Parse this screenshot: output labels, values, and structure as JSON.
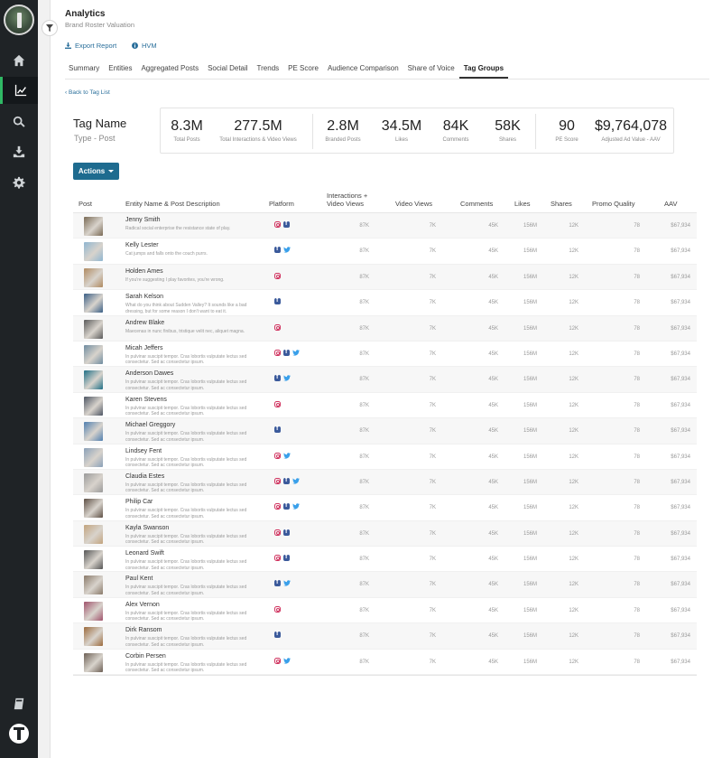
{
  "sidebar": {
    "items": [
      {
        "icon": "home-icon"
      },
      {
        "icon": "analytics-icon",
        "active": true
      },
      {
        "icon": "search-icon"
      },
      {
        "icon": "download-icon"
      },
      {
        "icon": "gear-icon"
      }
    ],
    "bottom_icon": "book-icon"
  },
  "header": {
    "title": "Analytics",
    "subtitle": "Brand Roster Valuation",
    "export_label": "Export Report",
    "hvm_label": "HVM"
  },
  "tabs": [
    {
      "label": "Summary"
    },
    {
      "label": "Entities"
    },
    {
      "label": "Aggregated Posts"
    },
    {
      "label": "Social Detail"
    },
    {
      "label": "Trends"
    },
    {
      "label": "PE Score"
    },
    {
      "label": "Audience Comparison"
    },
    {
      "label": "Share of Voice"
    },
    {
      "label": "Tag Groups",
      "active": true
    }
  ],
  "back_link": "Back to Tag List",
  "tag": {
    "name": "Tag Name",
    "type": "Type - Post"
  },
  "kpis": [
    {
      "value": "8.3M",
      "label": "Total Posts"
    },
    {
      "value": "277.5M",
      "label": "Total Interactions & Video Views"
    },
    {
      "value": "2.8M",
      "label": "Branded Posts"
    },
    {
      "value": "34.5M",
      "label": "Likes"
    },
    {
      "value": "84K",
      "label": "Comments"
    },
    {
      "value": "58K",
      "label": "Shares"
    },
    {
      "value": "90",
      "label": "PE Score"
    },
    {
      "value": "$9,764,078",
      "label": "Adjusted Ad Value - AAV"
    }
  ],
  "actions_label": "Actions",
  "table": {
    "headers": {
      "post": "Post",
      "entity": "Entity Name & Post Description",
      "platform": "Platform",
      "interactions_1": "Interactions +",
      "interactions_2": "Video Views",
      "video_views": "Video Views",
      "comments": "Comments",
      "likes": "Likes",
      "shares": "Shares",
      "promo": "Promo Quality",
      "aav": "AAV"
    },
    "rows": [
      {
        "name": "Jenny Smith",
        "desc": "Radical social enterprise the resistance state of play.",
        "platforms": [
          "ig",
          "fb"
        ],
        "interactions": "87K",
        "video_views": "7K",
        "comments": "45K",
        "likes": "156M",
        "shares": "12K",
        "promo": "78",
        "aav": "$67,934",
        "thumb": "#7a6a55"
      },
      {
        "name": "Kelly Lester",
        "desc": "Cat jumps and falls onto the couch purrs.",
        "platforms": [
          "fb",
          "tw"
        ],
        "interactions": "87K",
        "video_views": "7K",
        "comments": "45K",
        "likes": "156M",
        "shares": "12K",
        "promo": "78",
        "aav": "$67,934",
        "thumb": "#8fb6d1"
      },
      {
        "name": "Holden Ames",
        "desc": "If you're suggesting I play favorites, you're wrong.",
        "platforms": [
          "ig"
        ],
        "interactions": "87K",
        "video_views": "7K",
        "comments": "45K",
        "likes": "156M",
        "shares": "12K",
        "promo": "78",
        "aav": "$67,934",
        "thumb": "#b08a60"
      },
      {
        "name": "Sarah Kelson",
        "desc": "What do you think about Sudden Valley? It sounds like a bad dressing, but for some reason I don't want to eat it.",
        "platforms": [
          "fb"
        ],
        "interactions": "87K",
        "video_views": "7K",
        "comments": "45K",
        "likes": "156M",
        "shares": "12K",
        "promo": "78",
        "aav": "$67,934",
        "thumb": "#3a5f86"
      },
      {
        "name": "Andrew Blake",
        "desc": "Maecenas in nunc finibus, tristique velit nec, aliquet magna.",
        "platforms": [
          "ig"
        ],
        "interactions": "87K",
        "video_views": "7K",
        "comments": "45K",
        "likes": "156M",
        "shares": "12K",
        "promo": "78",
        "aav": "$67,934",
        "thumb": "#5a5a5a"
      },
      {
        "name": "Micah Jeffers",
        "desc": "In pulvinar suscipit tempor. Cras lobortis vulputate lectus sed consectetur. Sed ac consectetur ipsum.",
        "platforms": [
          "ig",
          "fb",
          "tw"
        ],
        "interactions": "87K",
        "video_views": "7K",
        "comments": "45K",
        "likes": "156M",
        "shares": "12K",
        "promo": "78",
        "aav": "$67,934",
        "thumb": "#6f8ca0"
      },
      {
        "name": "Anderson Dawes",
        "desc": "In pulvinar suscipit tempor. Cras lobortis vulputate lectus sed consectetur. Sed ac consectetur ipsum.",
        "platforms": [
          "fb",
          "tw"
        ],
        "interactions": "87K",
        "video_views": "7K",
        "comments": "45K",
        "likes": "156M",
        "shares": "12K",
        "promo": "78",
        "aav": "$67,934",
        "thumb": "#1f6f86"
      },
      {
        "name": "Karen Stevens",
        "desc": "In pulvinar suscipit tempor. Cras lobortis vulputate lectus sed consectetur. Sed ac consectetur ipsum.",
        "platforms": [
          "ig"
        ],
        "interactions": "87K",
        "video_views": "7K",
        "comments": "45K",
        "likes": "156M",
        "shares": "12K",
        "promo": "78",
        "aav": "$67,934",
        "thumb": "#4d5563"
      },
      {
        "name": "Michael Greggory",
        "desc": "In pulvinar suscipit tempor. Cras lobortis vulputate lectus sed consectetur. Sed ac consectetur ipsum.",
        "platforms": [
          "fb"
        ],
        "interactions": "87K",
        "video_views": "7K",
        "comments": "45K",
        "likes": "156M",
        "shares": "12K",
        "promo": "78",
        "aav": "$67,934",
        "thumb": "#4f7fb0"
      },
      {
        "name": "Lindsey Fent",
        "desc": "In pulvinar suscipit tempor. Cras lobortis vulputate lectus sed consectetur. Sed ac consectetur ipsum.",
        "platforms": [
          "ig",
          "tw"
        ],
        "interactions": "87K",
        "video_views": "7K",
        "comments": "45K",
        "likes": "156M",
        "shares": "12K",
        "promo": "78",
        "aav": "$67,934",
        "thumb": "#8aa0b8"
      },
      {
        "name": "Claudia Estes",
        "desc": "In pulvinar suscipit tempor. Cras lobortis vulputate lectus sed consectetur. Sed ac consectetur ipsum.",
        "platforms": [
          "ig",
          "fb",
          "tw"
        ],
        "interactions": "87K",
        "video_views": "7K",
        "comments": "45K",
        "likes": "156M",
        "shares": "12K",
        "promo": "78",
        "aav": "$67,934",
        "thumb": "#9a9a9a"
      },
      {
        "name": "Philip Car",
        "desc": "In pulvinar suscipit tempor. Cras lobortis vulputate lectus sed consectetur. Sed ac consectetur ipsum.",
        "platforms": [
          "ig",
          "fb",
          "tw"
        ],
        "interactions": "87K",
        "video_views": "7K",
        "comments": "45K",
        "likes": "156M",
        "shares": "12K",
        "promo": "78",
        "aav": "$67,934",
        "thumb": "#5e5045"
      },
      {
        "name": "Kayla Swanson",
        "desc": "In pulvinar suscipit tempor. Cras lobortis vulputate lectus sed consectetur. Sed ac consectetur ipsum.",
        "platforms": [
          "ig",
          "fb"
        ],
        "interactions": "87K",
        "video_views": "7K",
        "comments": "45K",
        "likes": "156M",
        "shares": "12K",
        "promo": "78",
        "aav": "$67,934",
        "thumb": "#c2a47e"
      },
      {
        "name": "Leonard Swift",
        "desc": "In pulvinar suscipit tempor. Cras lobortis vulputate lectus sed consectetur. Sed ac consectetur ipsum.",
        "platforms": [
          "ig",
          "fb"
        ],
        "interactions": "87K",
        "video_views": "7K",
        "comments": "45K",
        "likes": "156M",
        "shares": "12K",
        "promo": "78",
        "aav": "$67,934",
        "thumb": "#555"
      },
      {
        "name": "Paul Kent",
        "desc": "In pulvinar suscipit tempor. Cras lobortis vulputate lectus sed consectetur. Sed ac consectetur ipsum.",
        "platforms": [
          "fb",
          "tw"
        ],
        "interactions": "87K",
        "video_views": "7K",
        "comments": "45K",
        "likes": "156M",
        "shares": "12K",
        "promo": "78",
        "aav": "$67,934",
        "thumb": "#8a7a6a"
      },
      {
        "name": "Alex Vernon",
        "desc": "In pulvinar suscipit tempor. Cras lobortis vulputate lectus sed consectetur. Sed ac consectetur ipsum.",
        "platforms": [
          "ig"
        ],
        "interactions": "87K",
        "video_views": "7K",
        "comments": "45K",
        "likes": "156M",
        "shares": "12K",
        "promo": "78",
        "aav": "$67,934",
        "thumb": "#a0526b"
      },
      {
        "name": "Dirk Ransom",
        "desc": "In pulvinar suscipit tempor. Cras lobortis vulputate lectus sed consectetur. Sed ac consectetur ipsum.",
        "platforms": [
          "fb"
        ],
        "interactions": "87K",
        "video_views": "7K",
        "comments": "45K",
        "likes": "156M",
        "shares": "12K",
        "promo": "78",
        "aav": "$67,934",
        "thumb": "#9b6a3c"
      },
      {
        "name": "Corbin Persen",
        "desc": "In pulvinar suscipit tempor. Cras lobortis vulputate lectus sed consectetur. Sed ac consectetur ipsum.",
        "platforms": [
          "ig",
          "tw"
        ],
        "interactions": "87K",
        "video_views": "7K",
        "comments": "45K",
        "likes": "156M",
        "shares": "12K",
        "promo": "78",
        "aav": "$67,934",
        "thumb": "#6d6055"
      }
    ]
  }
}
